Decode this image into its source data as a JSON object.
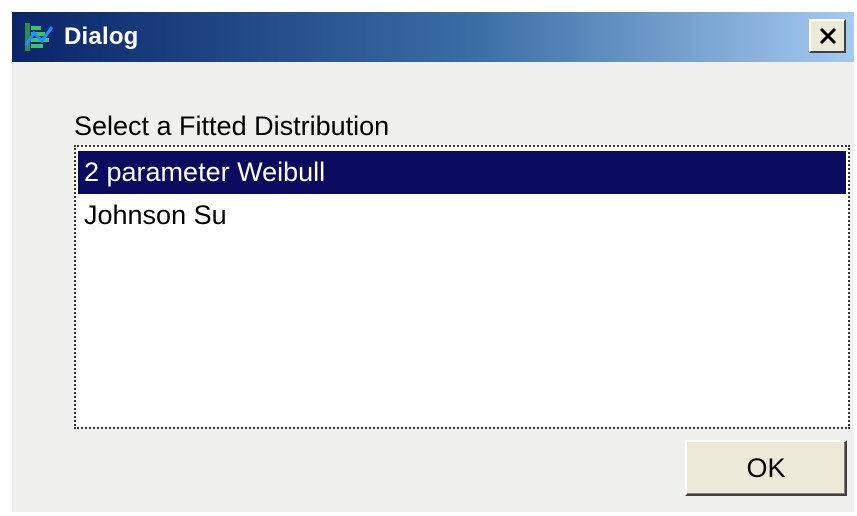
{
  "window": {
    "title": "Dialog",
    "app_icon": "distribution-app-icon",
    "close_icon": "close-icon"
  },
  "main": {
    "prompt": "Select a Fitted Distribution",
    "items": [
      {
        "label": "2 parameter Weibull",
        "selected": true
      },
      {
        "label": "Johnson Su",
        "selected": false
      }
    ],
    "ok_label": "OK"
  },
  "colors": {
    "titlebar_start": "#0a246a",
    "titlebar_end": "#a6caf0",
    "selection": "#0a0a5e",
    "dialog_bg": "#f0f0ee"
  }
}
